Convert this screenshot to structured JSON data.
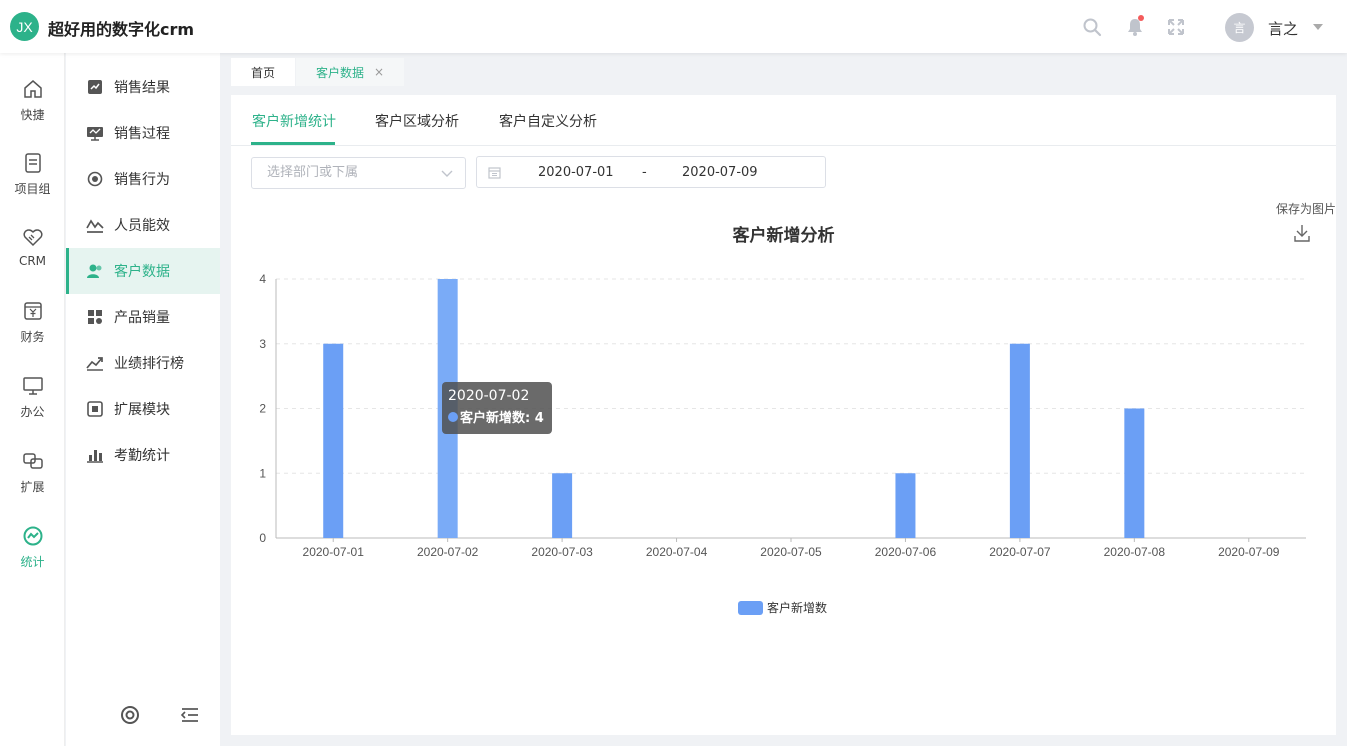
{
  "header": {
    "logo_text": "JX",
    "title": "超好用的数字化crm",
    "icons": [
      "search-icon",
      "bell-icon",
      "fullscreen-icon"
    ],
    "avatar_text": "言",
    "username": "言之"
  },
  "rail": {
    "items": [
      {
        "label": "快捷",
        "icon": "home-icon"
      },
      {
        "label": "项目组",
        "icon": "document-icon"
      },
      {
        "label": "CRM",
        "icon": "handshake-icon"
      },
      {
        "label": "财务",
        "icon": "yen-icon"
      },
      {
        "label": "办公",
        "icon": "monitor-icon"
      },
      {
        "label": "扩展",
        "icon": "extend-icon"
      },
      {
        "label": "统计",
        "icon": "stats-icon",
        "active": true
      }
    ]
  },
  "submenu": {
    "items": [
      {
        "label": "销售结果",
        "icon": "sales-result-icon"
      },
      {
        "label": "销售过程",
        "icon": "sales-process-icon"
      },
      {
        "label": "销售行为",
        "icon": "sales-behavior-icon"
      },
      {
        "label": "人员能效",
        "icon": "efficiency-icon"
      },
      {
        "label": "客户数据",
        "icon": "customer-icon",
        "active": true
      },
      {
        "label": "产品销量",
        "icon": "product-icon"
      },
      {
        "label": "业绩排行榜",
        "icon": "ranking-icon"
      },
      {
        "label": "扩展模块",
        "icon": "module-icon"
      },
      {
        "label": "考勤统计",
        "icon": "attendance-icon"
      }
    ]
  },
  "page_tabs": {
    "home": "首页",
    "current": "客户数据",
    "close": "×"
  },
  "tabs": {
    "t1": "客户新增统计",
    "t2": "客户区域分析",
    "t3": "客户自定义分析"
  },
  "filters": {
    "dept_placeholder": "选择部门或下属",
    "date_start": "2020-07-01",
    "date_sep": "-",
    "date_end": "2020-07-09"
  },
  "save_label": "保存为图片",
  "tooltip": {
    "title": "2020-07-02",
    "row": "客户新增数: 4"
  },
  "colors": {
    "accent": "#2db28a",
    "bar": "#6b9ff5",
    "bar_highlight": "#7aabf7"
  },
  "chart_data": {
    "type": "bar",
    "title": "客户新增分析",
    "categories": [
      "2020-07-01",
      "2020-07-02",
      "2020-07-03",
      "2020-07-04",
      "2020-07-05",
      "2020-07-06",
      "2020-07-07",
      "2020-07-08",
      "2020-07-09"
    ],
    "series": [
      {
        "name": "客户新增数",
        "values": [
          3,
          4,
          1,
          0,
          0,
          1,
          3,
          2,
          0
        ]
      }
    ],
    "ylim": [
      0,
      4
    ],
    "yticks": [
      0,
      1,
      2,
      3,
      4
    ],
    "grid": true,
    "legend": "bottom-center"
  }
}
